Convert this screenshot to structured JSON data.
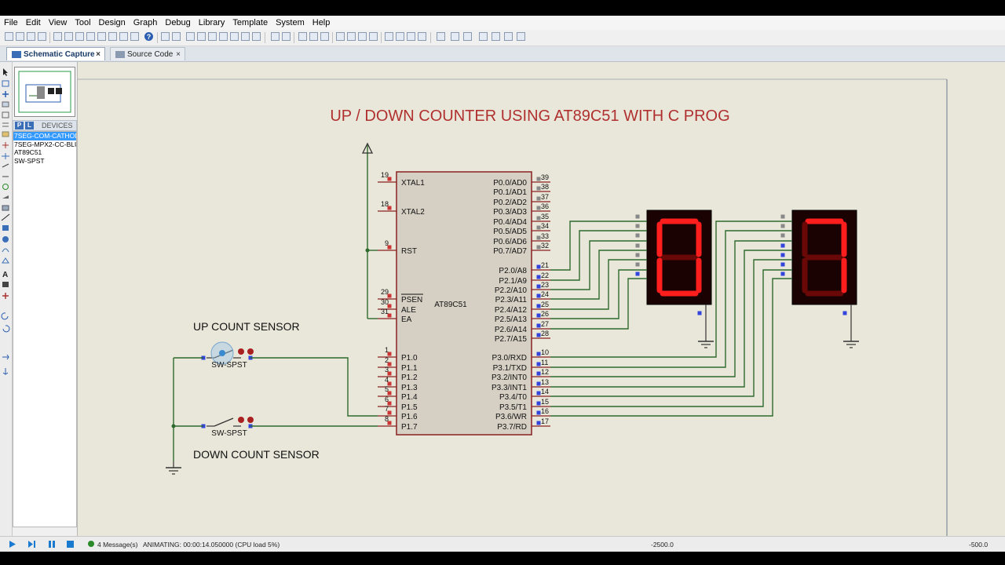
{
  "menu": [
    "File",
    "Edit",
    "View",
    "Tool",
    "Design",
    "Graph",
    "Debug",
    "Library",
    "Template",
    "System",
    "Help"
  ],
  "tabs": {
    "schematic": "Schematic Capture",
    "source": "Source Code",
    "close": "×"
  },
  "devices": {
    "header": "DEVICES",
    "p_button": "P",
    "l_button": "L",
    "items": [
      "7SEG-COM-CATHODE",
      "7SEG-MPX2-CC-BLUE",
      "AT89C51",
      "SW-SPST"
    ],
    "selected_index": 0
  },
  "schematic": {
    "title": "UP / DOWN COUNTER USING AT89C51 WITH C PROG",
    "title_color": "#b03030",
    "chip_name": "AT89C51",
    "left_pins": [
      {
        "num": "19",
        "label": "XTAL1"
      },
      {
        "num": "18",
        "label": "XTAL2"
      },
      {
        "num": "9",
        "label": "RST"
      },
      {
        "num": "29",
        "label": "PSEN"
      },
      {
        "num": "30",
        "label": "ALE"
      },
      {
        "num": "31",
        "label": "EA"
      },
      {
        "num": "1",
        "label": "P1.0"
      },
      {
        "num": "2",
        "label": "P1.1"
      },
      {
        "num": "3",
        "label": "P1.2"
      },
      {
        "num": "4",
        "label": "P1.3"
      },
      {
        "num": "5",
        "label": "P1.4"
      },
      {
        "num": "6",
        "label": "P1.5"
      },
      {
        "num": "7",
        "label": "P1.6"
      },
      {
        "num": "8",
        "label": "P1.7"
      }
    ],
    "right_pins": [
      {
        "num": "39",
        "label": "P0.0/AD0"
      },
      {
        "num": "38",
        "label": "P0.1/AD1"
      },
      {
        "num": "37",
        "label": "P0.2/AD2"
      },
      {
        "num": "36",
        "label": "P0.3/AD3"
      },
      {
        "num": "35",
        "label": "P0.4/AD4"
      },
      {
        "num": "34",
        "label": "P0.5/AD5"
      },
      {
        "num": "33",
        "label": "P0.6/AD6"
      },
      {
        "num": "32",
        "label": "P0.7/AD7"
      },
      {
        "num": "21",
        "label": "P2.0/A8"
      },
      {
        "num": "22",
        "label": "P2.1/A9"
      },
      {
        "num": "23",
        "label": "P2.2/A10"
      },
      {
        "num": "24",
        "label": "P2.3/A11"
      },
      {
        "num": "25",
        "label": "P2.4/A12"
      },
      {
        "num": "26",
        "label": "P2.5/A13"
      },
      {
        "num": "27",
        "label": "P2.6/A14"
      },
      {
        "num": "28",
        "label": "P2.7/A15"
      },
      {
        "num": "10",
        "label": "P3.0/RXD"
      },
      {
        "num": "11",
        "label": "P3.1/TXD"
      },
      {
        "num": "12",
        "label": "P3.2/INT0"
      },
      {
        "num": "13",
        "label": "P3.3/INT1"
      },
      {
        "num": "14",
        "label": "P3.4/T0"
      },
      {
        "num": "15",
        "label": "P3.5/T1"
      },
      {
        "num": "16",
        "label": "P3.6/WR"
      },
      {
        "num": "17",
        "label": "P3.7/RD"
      }
    ],
    "up_label": "UP COUNT SENSOR",
    "down_label": "DOWN COUNT SENSOR",
    "switch_name": "SW-SPST",
    "digit1": "0",
    "digit2": "7",
    "seg_on": "#ff1e1e",
    "seg_off": "#6a0808",
    "wire_color": "#2e6a2e",
    "chip_fill": "#d6d0c4",
    "chip_border": "#8a2020"
  },
  "status": {
    "messages": "4 Message(s)",
    "animating": "ANIMATING: 00:00:14.050000 (CPU load 5%)",
    "coord_x": "-2500.0",
    "coord_y": "-500.0"
  }
}
